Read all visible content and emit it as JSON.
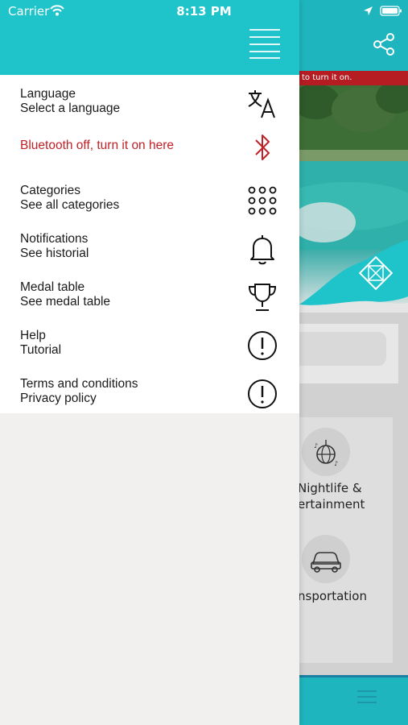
{
  "status_bar": {
    "carrier": "Carrier",
    "time": "8:13 PM"
  },
  "background_app": {
    "banner_text": "to turn it on.",
    "categories": [
      {
        "label_line1": "Nightlife &",
        "label_line2": "ertainment",
        "icon": "disco-ball-icon"
      },
      {
        "label_line1": "nsportation",
        "label_line2": "",
        "icon": "car-icon"
      }
    ]
  },
  "drawer": {
    "items": [
      {
        "title": "Language",
        "subtitle": "Select a language",
        "icon": "translate-icon"
      },
      {
        "title": "Bluetooth off, turn it on here",
        "icon": "bluetooth-icon",
        "color": "#c02127"
      },
      {
        "title": "Categories",
        "subtitle": "See all categories",
        "icon": "grid-dots-icon"
      },
      {
        "title": "Notifications",
        "subtitle": "See historial",
        "icon": "bell-icon"
      },
      {
        "title": "Medal table",
        "subtitle": "See medal table",
        "icon": "trophy-icon"
      },
      {
        "title": "Help",
        "subtitle": "Tutorial",
        "icon": "alert-circle-icon"
      },
      {
        "title": "Terms and conditions",
        "subtitle": "Privacy policy",
        "icon": "alert-circle-icon"
      }
    ]
  },
  "colors": {
    "header_teal": "#1fc3ca",
    "alert_red": "#c02127",
    "drawer_bg": "#f1f0ee"
  }
}
